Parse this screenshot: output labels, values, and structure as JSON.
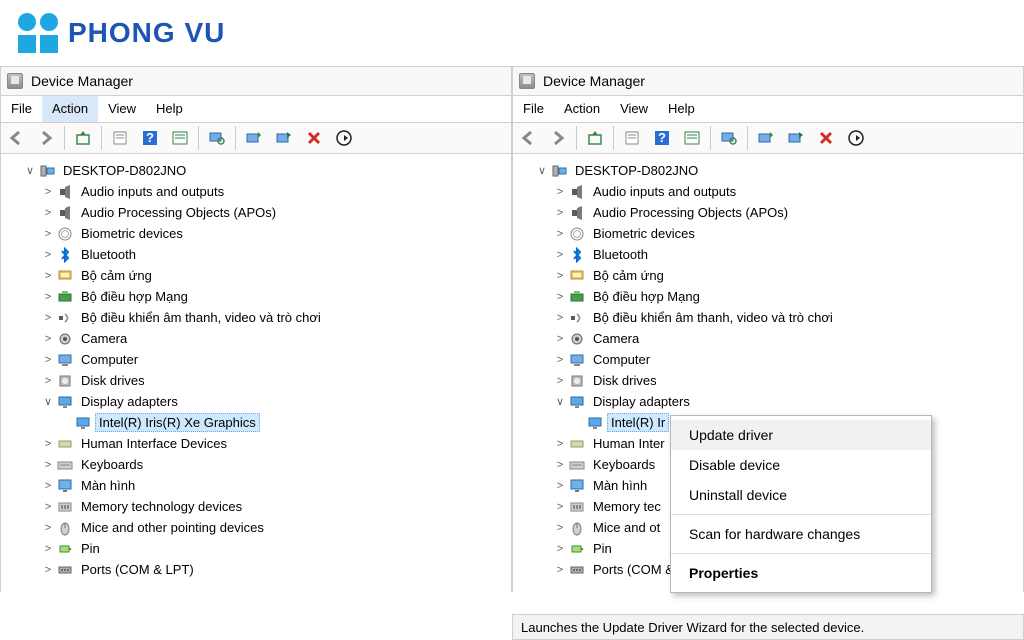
{
  "logo_text": "PHONG VU",
  "window_title": "Device Manager",
  "menus": {
    "file": "File",
    "action": "Action",
    "view": "View",
    "help": "Help"
  },
  "root": "DESKTOP-D802JNO",
  "nodes": [
    {
      "label": "Audio inputs and outputs",
      "icon": "speaker"
    },
    {
      "label": "Audio Processing Objects (APOs)",
      "icon": "speaker"
    },
    {
      "label": "Biometric devices",
      "icon": "fingerprint"
    },
    {
      "label": "Bluetooth",
      "icon": "bluetooth"
    },
    {
      "label": "Bộ cảm ứng",
      "icon": "touch"
    },
    {
      "label": "Bộ điều hợp Mạng",
      "icon": "network"
    },
    {
      "label": "Bộ điều khiển âm thanh, video và trò chơi",
      "icon": "sound"
    },
    {
      "label": "Camera",
      "icon": "camera"
    },
    {
      "label": "Computer",
      "icon": "computer"
    },
    {
      "label": "Disk drives",
      "icon": "disk"
    },
    {
      "label": "Display adapters",
      "icon": "display",
      "expanded": true,
      "children": [
        {
          "label": "Intel(R) Iris(R) Xe Graphics",
          "icon": "display",
          "selected": true
        }
      ]
    },
    {
      "label": "Human Interface Devices",
      "icon": "hid"
    },
    {
      "label": "Keyboards",
      "icon": "keyboard"
    },
    {
      "label": "Màn hình",
      "icon": "monitor"
    },
    {
      "label": "Memory technology devices",
      "icon": "memory"
    },
    {
      "label": "Mice and other pointing devices",
      "icon": "mouse"
    },
    {
      "label": "Pin",
      "icon": "battery"
    },
    {
      "label": "Ports (COM & LPT)",
      "icon": "port"
    }
  ],
  "right_child_trunc": "Intel(R) Ir",
  "right_trunc": {
    "11": "Human Inter",
    "12": "Keyboards",
    "13": "Màn hình",
    "14": "Memory tec",
    "15": "Mice and ot",
    "16": "Pin",
    "17": "Ports (COM & LP I"
  },
  "context": {
    "update": "Update driver",
    "disable": "Disable device",
    "uninstall": "Uninstall device",
    "scan": "Scan for hardware changes",
    "props": "Properties"
  },
  "status_text": "Launches the Update Driver Wizard for the selected device.",
  "colors": {
    "accent": "#1ea7e0",
    "select": "#cde8ff"
  }
}
